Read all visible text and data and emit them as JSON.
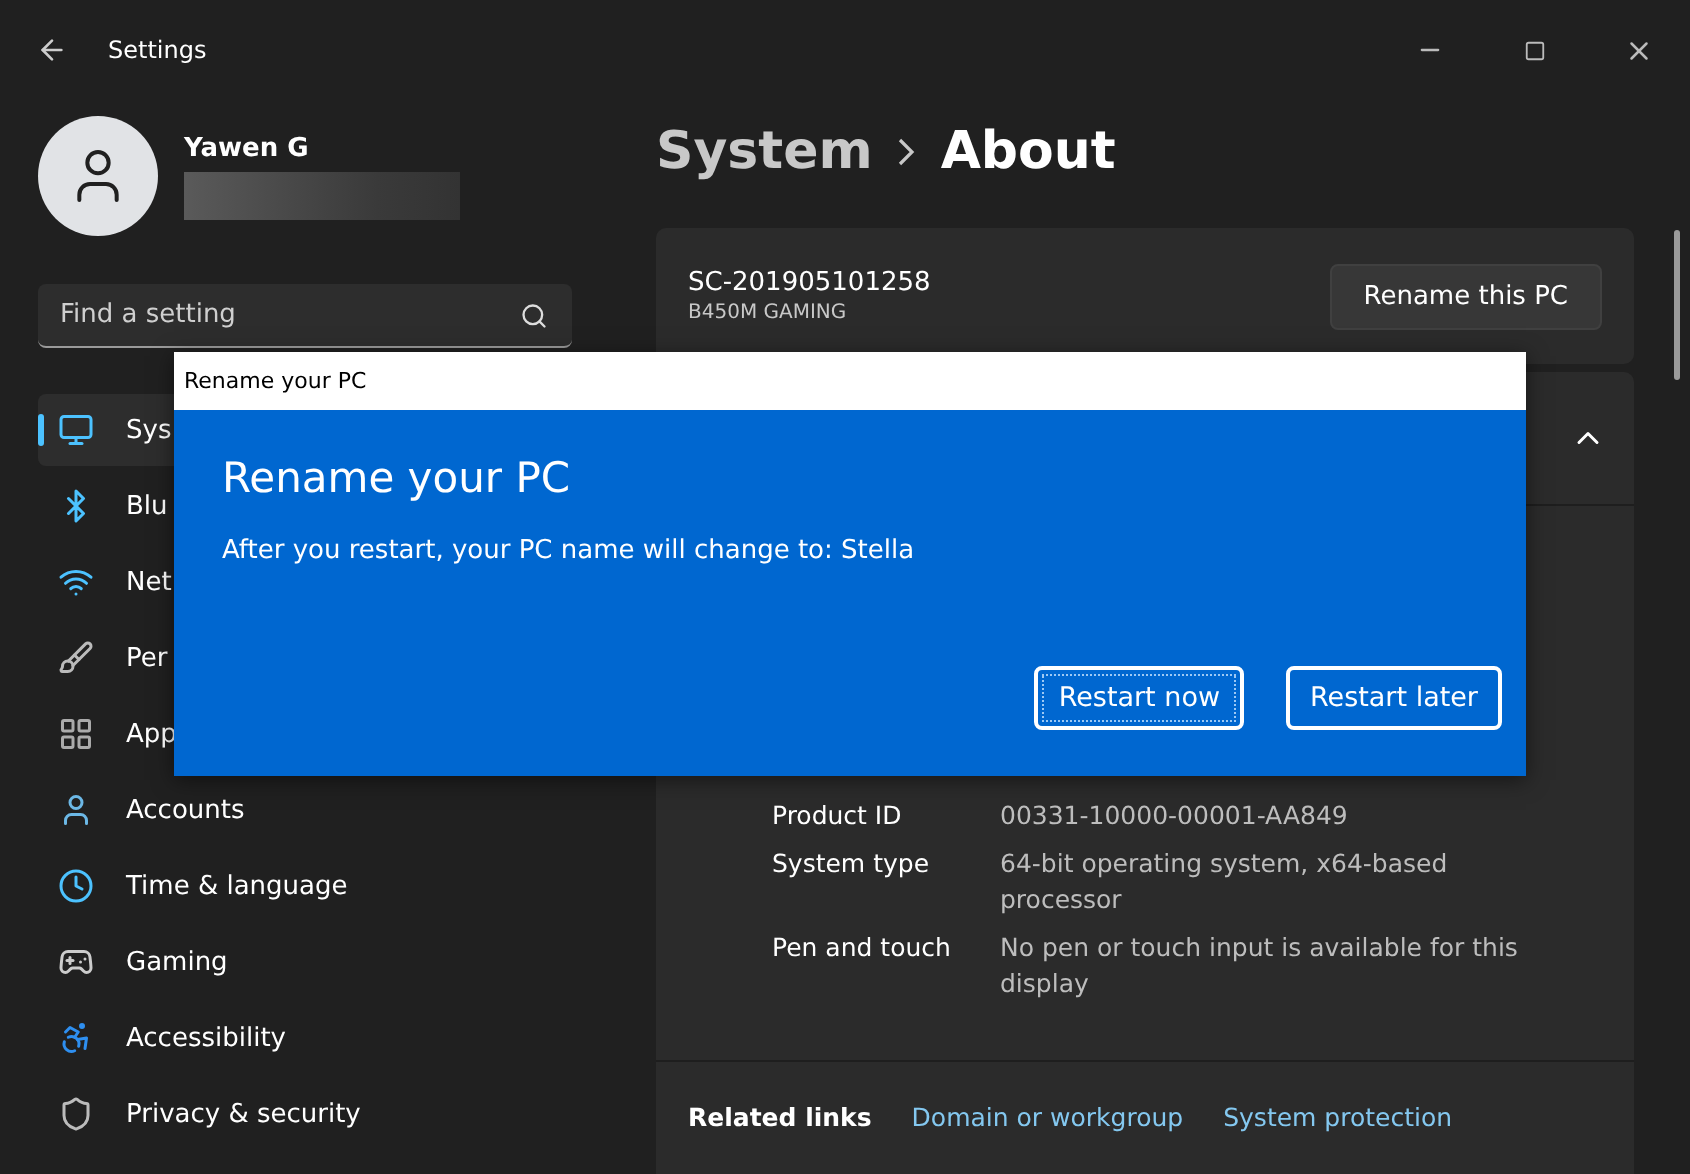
{
  "window": {
    "title": "Settings"
  },
  "user": {
    "name": "Yawen G"
  },
  "search": {
    "placeholder": "Find a setting"
  },
  "nav": [
    {
      "label": "Sys",
      "selected": true
    },
    {
      "label": "Blu",
      "selected": false
    },
    {
      "label": "Net",
      "selected": false
    },
    {
      "label": "Per",
      "selected": false
    },
    {
      "label": "App",
      "selected": false
    },
    {
      "label": "Accounts",
      "selected": false
    },
    {
      "label": "Time & language",
      "selected": false
    },
    {
      "label": "Gaming",
      "selected": false
    },
    {
      "label": "Accessibility",
      "selected": false
    },
    {
      "label": "Privacy & security",
      "selected": false
    }
  ],
  "breadcrumb": [
    "System",
    "About"
  ],
  "device": {
    "name": "SC-201905101258",
    "model": "B450M GAMING",
    "button": "Rename this PC"
  },
  "specs_section": {
    "expanded": true
  },
  "specs": [
    {
      "label": "Product ID",
      "value": "00331-10000-00001-AA849"
    },
    {
      "label": "System type",
      "value": "64-bit operating system, x64-based processor"
    },
    {
      "label": "Pen and touch",
      "value": "No pen or touch input is available for this display"
    }
  ],
  "related_links": {
    "label": "Related links",
    "links": [
      "Domain or workgroup",
      "System protection"
    ]
  },
  "dialog": {
    "title": "Rename your PC",
    "heading": "Rename your PC",
    "message": "After you restart, your PC name will change to: Stella",
    "buttons": [
      {
        "label": "Restart now",
        "focused": true
      },
      {
        "label": "Restart later",
        "focused": false
      }
    ]
  }
}
